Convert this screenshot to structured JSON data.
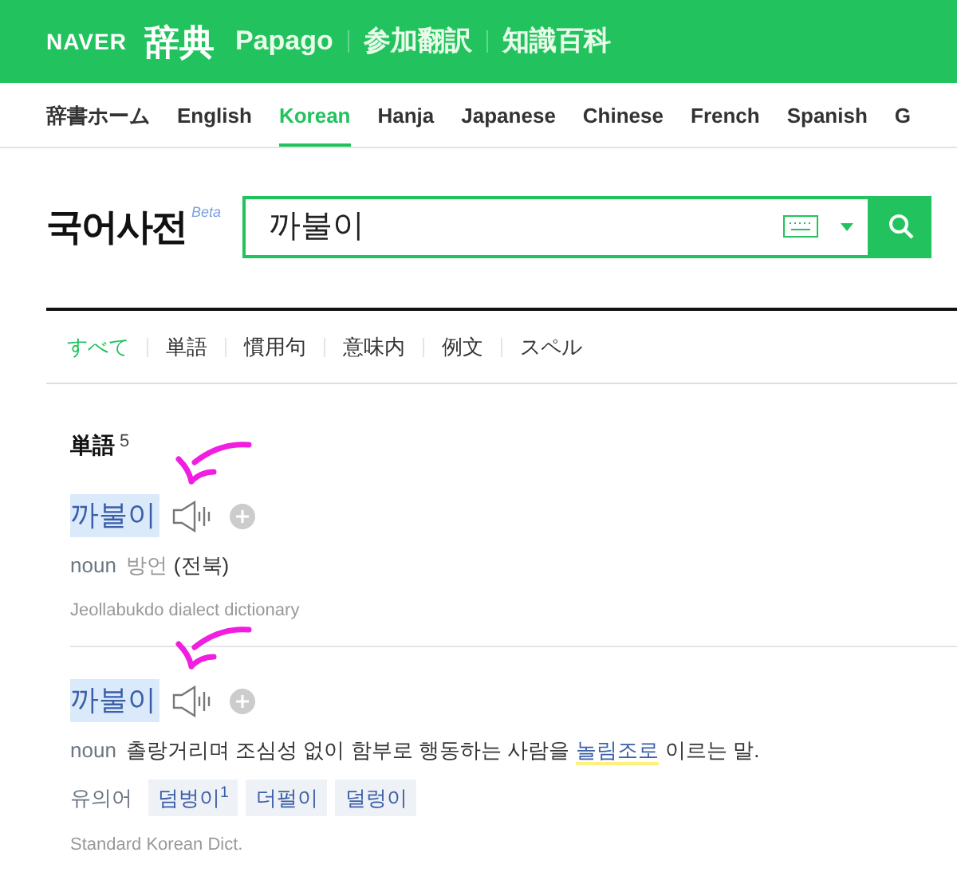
{
  "header": {
    "logo": "NAVER",
    "service": "辞典",
    "links": [
      "Papago",
      "参加翻訳",
      "知識百科"
    ]
  },
  "nav_tabs": [
    {
      "label": "辞書ホーム",
      "selected": false
    },
    {
      "label": "English",
      "selected": false
    },
    {
      "label": "Korean",
      "selected": true
    },
    {
      "label": "Hanja",
      "selected": false
    },
    {
      "label": "Japanese",
      "selected": false
    },
    {
      "label": "Chinese",
      "selected": false
    },
    {
      "label": "French",
      "selected": false
    },
    {
      "label": "Spanish",
      "selected": false
    },
    {
      "label": "G",
      "selected": false
    }
  ],
  "search": {
    "title": "국어사전",
    "badge": "Beta",
    "value": "까불이"
  },
  "filter_tabs": [
    {
      "label": "すべて",
      "selected": true
    },
    {
      "label": "単語",
      "selected": false
    },
    {
      "label": "慣用句",
      "selected": false
    },
    {
      "label": "意味内",
      "selected": false
    },
    {
      "label": "例文",
      "selected": false
    },
    {
      "label": "スペル",
      "selected": false
    }
  ],
  "section": {
    "title": "単語",
    "count": "5"
  },
  "entries": [
    {
      "headword": "까불이",
      "annotated": true,
      "pos": "noun",
      "definition": [
        {
          "kind": "tag",
          "text": "방언"
        },
        {
          "kind": "plain",
          "text": "(전북)"
        }
      ],
      "source": "Jeollabukdo dialect dictionary"
    },
    {
      "headword": "까불이",
      "annotated": true,
      "pos": "noun",
      "definition": [
        {
          "kind": "plain",
          "text": "촐랑거리며 조심성 없이 함부로 행동하는 사람을"
        },
        {
          "kind": "link",
          "text": "놀림조로"
        },
        {
          "kind": "plain",
          "text": "이르는 말."
        }
      ],
      "synonyms": {
        "label": "유의어",
        "items": [
          "덤벙이$^{1}$",
          "더펄이",
          "덜렁이"
        ]
      },
      "source": "Standard Korean Dict."
    }
  ]
}
